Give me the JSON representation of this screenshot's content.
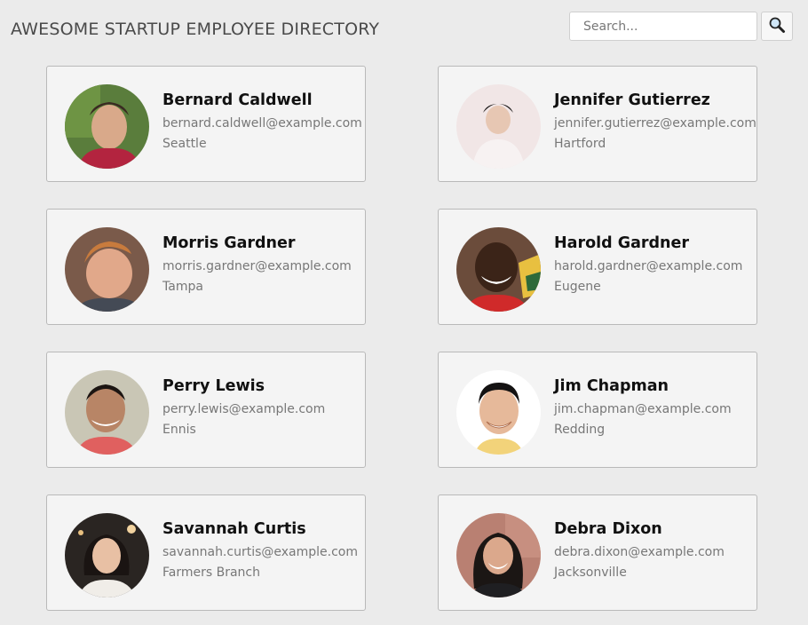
{
  "header": {
    "title": "AWESOME STARTUP EMPLOYEE DIRECTORY"
  },
  "search": {
    "placeholder": "Search...",
    "value": "",
    "icon": "magnifier-icon"
  },
  "employees": [
    {
      "name": "Bernard Caldwell",
      "email": "bernard.caldwell@example.com",
      "city": "Seattle"
    },
    {
      "name": "Jennifer Gutierrez",
      "email": "jennifer.gutierrez@example.com",
      "city": "Hartford"
    },
    {
      "name": "Morris Gardner",
      "email": "morris.gardner@example.com",
      "city": "Tampa"
    },
    {
      "name": "Harold Gardner",
      "email": "harold.gardner@example.com",
      "city": "Eugene"
    },
    {
      "name": "Perry Lewis",
      "email": "perry.lewis@example.com",
      "city": "Ennis"
    },
    {
      "name": "Jim Chapman",
      "email": "jim.chapman@example.com",
      "city": "Redding"
    },
    {
      "name": "Savannah Curtis",
      "email": "savannah.curtis@example.com",
      "city": "Farmers Branch"
    },
    {
      "name": "Debra Dixon",
      "email": "debra.dixon@example.com",
      "city": "Jacksonville"
    }
  ],
  "colors": {
    "background": "#ebebeb",
    "card": "#f4f4f4",
    "card_border": "#b9b9b9",
    "title_text": "#4a4a4a",
    "secondary_text": "#777777"
  }
}
